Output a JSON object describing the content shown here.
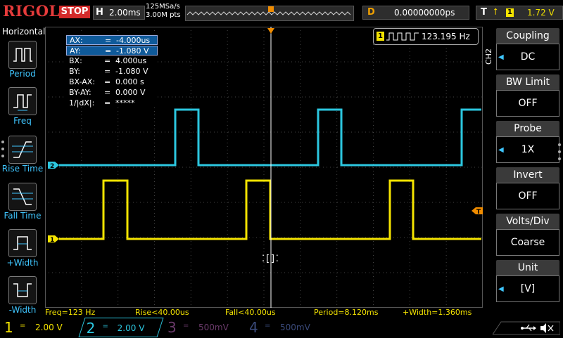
{
  "topbar": {
    "brand": "RIGOL",
    "run_state": "STOP",
    "timebase_label": "H",
    "timebase_value": "2.00ms",
    "sample_rate": "125MSa/s",
    "memory_depth": "3.00M pts",
    "delay_label": "D",
    "delay_value": "0.00000000ps",
    "trigger_label": "T",
    "trigger_source": "1",
    "trigger_level": "1.72 V"
  },
  "left_menu": {
    "title": "Horizontal",
    "items": [
      {
        "label": "Period",
        "icon": "period-icon"
      },
      {
        "label": "Freq",
        "icon": "freq-icon"
      },
      {
        "label": "Rise Time",
        "icon": "rise-time-icon"
      },
      {
        "label": "Fall Time",
        "icon": "fall-time-icon"
      },
      {
        "label": "+Width",
        "icon": "positive-width-icon"
      },
      {
        "label": "-Width",
        "icon": "negative-width-icon"
      }
    ]
  },
  "cursor_panel": {
    "rows": [
      {
        "key": "AX:",
        "eq": "=",
        "value": "-4.000us",
        "highlight": true
      },
      {
        "key": "AY:",
        "eq": "=",
        "value": "-1.080 V",
        "highlight": true
      },
      {
        "key": "BX:",
        "eq": "=",
        "value": "4.000us",
        "highlight": false
      },
      {
        "key": "BY:",
        "eq": "=",
        "value": "-1.080 V",
        "highlight": false
      },
      {
        "key": "BX-AX:",
        "eq": "=",
        "value": "0.000 s",
        "highlight": false
      },
      {
        "key": "BY-AY:",
        "eq": "=",
        "value": "0.000 V",
        "highlight": false
      },
      {
        "key": "1/|dX|:",
        "eq": "=",
        "value": "*****",
        "highlight": false
      }
    ]
  },
  "freq_badge": {
    "channel": "1",
    "value": "123.195 Hz"
  },
  "channel_markers": {
    "ch1": "1",
    "ch2": "2",
    "trigger": "T"
  },
  "right_menu": {
    "channel_tag": "CH2",
    "items": [
      {
        "title": "Coupling",
        "value": "DC"
      },
      {
        "title": "BW Limit",
        "value": "OFF"
      },
      {
        "title": "Probe",
        "value": "1X"
      },
      {
        "title": "Invert",
        "value": "OFF"
      },
      {
        "title": "Volts/Div",
        "value": "Coarse"
      },
      {
        "title": "Unit",
        "value": "[V]"
      }
    ]
  },
  "measurements": [
    {
      "text": "Freq=123 Hz"
    },
    {
      "text": "Rise<40.00us"
    },
    {
      "text": "Fall<40.00us"
    },
    {
      "text": "Period=8.120ms"
    },
    {
      "text": "+Width=1.360ms"
    }
  ],
  "channels": [
    {
      "num": "1",
      "coupling": "=",
      "vdiv": "2.00 V",
      "color": "#f5e400"
    },
    {
      "num": "2",
      "coupling": "=",
      "vdiv": "2.00 V",
      "color": "#2cc7e0"
    },
    {
      "num": "3",
      "coupling": "=",
      "vdiv": "500mV",
      "color": "#6a3a6a"
    },
    {
      "num": "4",
      "coupling": "=",
      "vdiv": "500mV",
      "color": "#3a4a7a"
    }
  ],
  "colors": {
    "ch1": "#f5e400",
    "ch2": "#2cc7e0",
    "trigger": "#f08c00",
    "accent": "#3fc6ff",
    "stop": "#d42a2a"
  }
}
